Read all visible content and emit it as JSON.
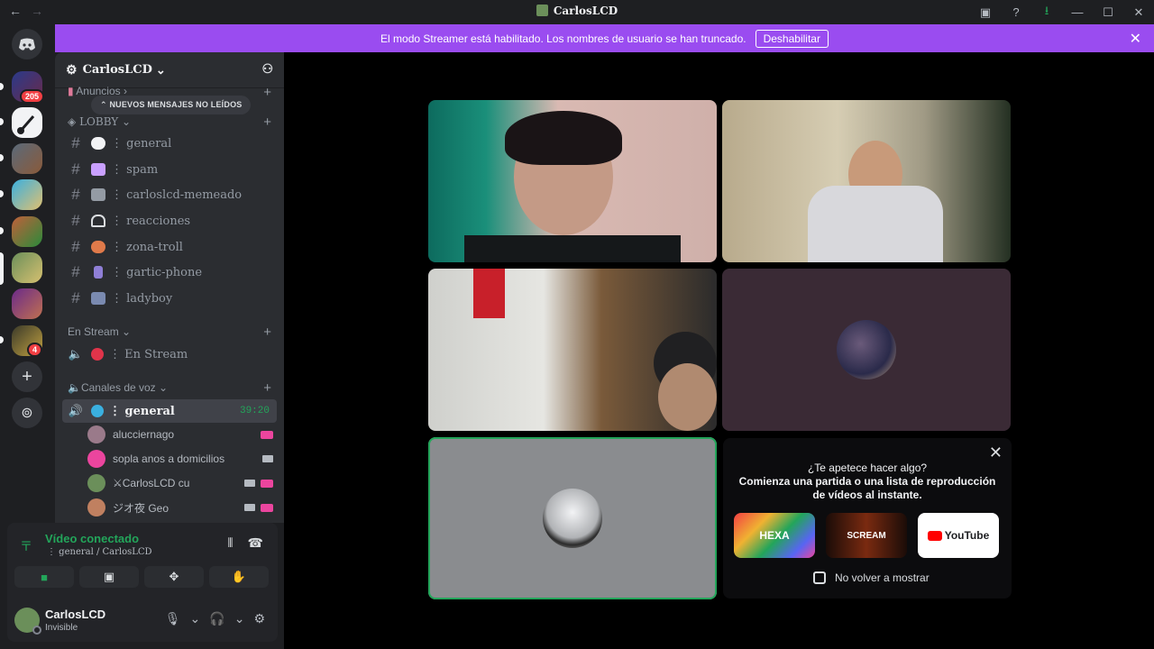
{
  "titlebar": {
    "back": "←",
    "forward": "→",
    "title": "CarlosLCD",
    "icons": [
      "inbox-icon",
      "help-icon",
      "download-icon",
      "minimize-icon",
      "maximize-icon",
      "close-icon"
    ],
    "glyphs": {
      "inbox": "▣",
      "help": "?",
      "download": "⭳",
      "min": "—",
      "max": "☐",
      "close": "✕"
    }
  },
  "banner": {
    "text": "El modo Streamer está habilitado. Los nombres de usuario se han truncado.",
    "button": "Deshabilitar",
    "close": "✕"
  },
  "rail": {
    "badges": [
      "205",
      "4"
    ],
    "add": "+",
    "discover": "⊚"
  },
  "sidebar": {
    "server_name": "CarlosLCD",
    "server_chevron": "⌄",
    "gear": "⚙",
    "invite": "⚇",
    "unread_pill": "NUEVOS MENSAJES NO LEÍDOS",
    "categories": [
      {
        "label": "Anuncios",
        "chevron": "›"
      },
      {
        "label": "LOBBY",
        "chevron": "⌄"
      },
      {
        "label": "En Stream",
        "chevron": "⌄"
      },
      {
        "label": "Canales de voz",
        "chevron": "⌄"
      }
    ],
    "plus": "+",
    "hash": "#",
    "text_channels": [
      {
        "name": "⋮ general",
        "emoji_color": "#f2f3f5"
      },
      {
        "name": "⋮ spam",
        "emoji_color": "#c9a0ff"
      },
      {
        "name": "⋮ carloslcd-memeado",
        "emoji_color": "#949ba4"
      },
      {
        "name": "⋮ reacciones",
        "emoji_color": "#dbdee1"
      },
      {
        "name": "⋮ zona-troll",
        "emoji_color": "#e07a4a"
      },
      {
        "name": "⋮ gartic-phone",
        "emoji_color": "#8f7fd6"
      },
      {
        "name": "⋮ ladyboy",
        "emoji_color": "#7a8ab0"
      }
    ],
    "stream_channel": {
      "name": "⋮ En Stream",
      "emoji_color": "#e0344a"
    },
    "voice_channel": {
      "name": "⋮ general",
      "time": "39:20",
      "emoji_color": "#3ab0e0"
    },
    "voice_users": [
      {
        "name": "alucciernago",
        "avatar_color": "#9a7a8a",
        "live": true,
        "cam": false
      },
      {
        "name": "sopla anos a domicilios",
        "avatar_color": "#eb459e",
        "live": false,
        "cam": true
      },
      {
        "name": "⚔CarlosLCD cu",
        "avatar_color": "#6b8f5a",
        "live": true,
        "cam": true
      },
      {
        "name": "ジオ夜 Geo",
        "avatar_color": "#c08060",
        "live": true,
        "cam": true
      }
    ]
  },
  "voice_panel": {
    "title": "Vídeo conectado",
    "subtitle": "⋮ general / CarlosLCD",
    "signal": "〒",
    "soundboard": "⦀",
    "disconnect": "☎",
    "buttons": [
      "■",
      "▣",
      "✥",
      "✋"
    ]
  },
  "user_panel": {
    "name": "CarlosLCD",
    "status": "Invisible",
    "mic": "🎙",
    "headset": "🎧",
    "settings": "⚙",
    "chevron": "⌄"
  },
  "activity": {
    "close": "✕",
    "line1": "¿Te apetece hacer algo?",
    "line2": "Comienza una partida o una lista de reproducción",
    "line3": "de vídeos al instante.",
    "cards": [
      "HEXA",
      "SCREAM",
      "YouTube"
    ],
    "checkbox_label": "No volver a mostrar"
  },
  "colors": {
    "accent_green": "#23a55a",
    "banner_purple": "#9a4cf0",
    "badge_red": "#f23f43"
  }
}
